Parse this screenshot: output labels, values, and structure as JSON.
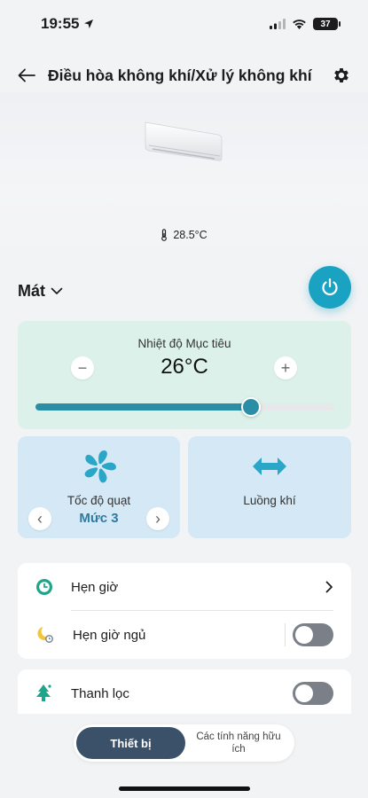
{
  "status_bar": {
    "time": "19:55",
    "battery": "37"
  },
  "header": {
    "title": "Điều hòa không khí/Xử lý không khí"
  },
  "hero": {
    "room_temperature": "28.5°C"
  },
  "mode": {
    "label": "Mát"
  },
  "target_temp": {
    "label": "Nhiệt độ Mục tiêu",
    "value": "26°C",
    "minus": "−",
    "plus": "+",
    "slider_fraction": 0.72
  },
  "fan": {
    "label": "Tốc độ quạt",
    "value": "Mức 3",
    "prev": "‹",
    "next": "›"
  },
  "airflow": {
    "label": "Luồng khí"
  },
  "settings": {
    "timer_label": "Hẹn giờ",
    "sleep_timer_label": "Hẹn giờ ngủ",
    "sleep_timer_on": false,
    "purify_label": "Thanh lọc",
    "purify_on": false
  },
  "bottom_tabs": {
    "active": "Thiết bị",
    "inactive": "Các tính năng hữu ích"
  },
  "colors": {
    "accent": "#1aa2c2",
    "slider": "#2a8fa6",
    "temp_card": "#dbf1ea",
    "fan_card": "#d5e8f5",
    "tab_active": "#3a5169"
  }
}
